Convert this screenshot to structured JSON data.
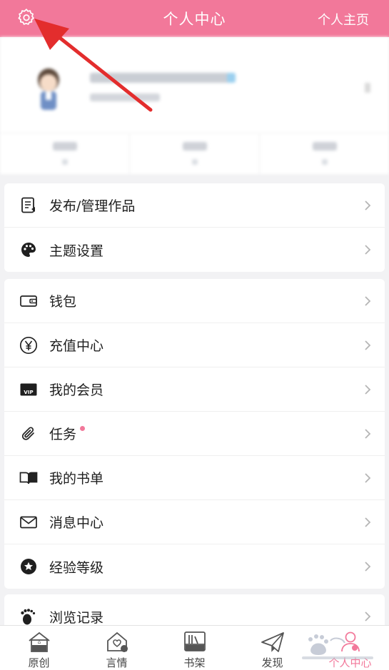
{
  "header": {
    "title": "个人中心",
    "homepage_link": "个人主页"
  },
  "colors": {
    "accent": "#f2789a",
    "annotation_arrow": "#e32d2d"
  },
  "menu_group_1": [
    {
      "label": "发布/管理作品",
      "icon": "document-icon"
    },
    {
      "label": "主题设置",
      "icon": "palette-icon"
    }
  ],
  "menu_group_2": [
    {
      "label": "钱包",
      "icon": "wallet-icon"
    },
    {
      "label": "充值中心",
      "icon": "yen-circle-icon"
    },
    {
      "label": "我的会员",
      "icon": "vip-card-icon",
      "badge_text": "VIP"
    },
    {
      "label": "任务",
      "icon": "paperclip-icon",
      "has_dot": true
    },
    {
      "label": "我的书单",
      "icon": "open-book-icon"
    },
    {
      "label": "消息中心",
      "icon": "envelope-icon"
    },
    {
      "label": "经验等级",
      "icon": "star-badge-icon"
    }
  ],
  "menu_group_3": [
    {
      "label": "浏览记录",
      "icon": "footprints-icon"
    }
  ],
  "tabbar": [
    {
      "label": "原创",
      "icon": "house-icon",
      "active": false
    },
    {
      "label": "言情",
      "icon": "house-heart-icon",
      "active": false
    },
    {
      "label": "书架",
      "icon": "bookshelf-icon",
      "active": false
    },
    {
      "label": "发现",
      "icon": "paper-plane-icon",
      "active": false
    },
    {
      "label": "个人中心",
      "icon": "person-icon",
      "active": true
    }
  ]
}
